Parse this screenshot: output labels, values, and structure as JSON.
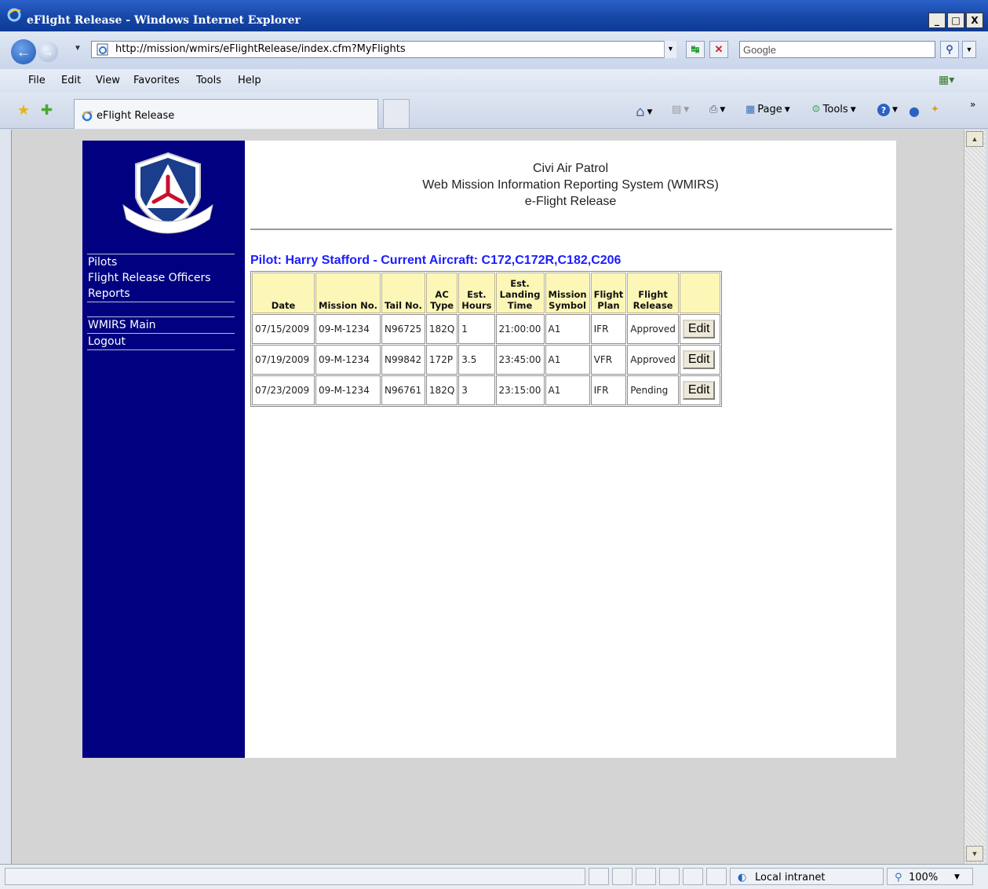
{
  "window": {
    "title": "eFlight Release - Windows Internet Explorer",
    "minimize": "_",
    "maximize": "□",
    "close": "X"
  },
  "address_bar": {
    "url": "http://mission/wmirs/eFlightRelease/index.cfm?MyFlights",
    "search_placeholder": "Google"
  },
  "menu": [
    "File",
    "Edit",
    "View",
    "Favorites",
    "Tools",
    "Help"
  ],
  "tab": {
    "label": "eFlight Release"
  },
  "commands": {
    "page": "Page",
    "tools": "Tools"
  },
  "sidebar": {
    "logo_text": "CIVIL AIR PATROL",
    "links": [
      "Pilots",
      "Flight Release Officers",
      "Reports",
      "WMIRS Main",
      "Logout"
    ]
  },
  "header": {
    "line1": "Civi Air Patrol",
    "line2": "Web Mission Information Reporting System (WMIRS)",
    "line3": "e-Flight Release"
  },
  "pilot_heading": "Pilot: Harry Stafford - Current Aircraft: C172,C172R,C182,C206",
  "table": {
    "headers": [
      "Date",
      "Mission No.",
      "Tail No.",
      "AC Type",
      "Est. Hours",
      "Est. Landing Time",
      "Mission Symbol",
      "Flight Plan",
      "Flight Release",
      ""
    ],
    "rows": [
      [
        "07/15/2009",
        "09-M-1234",
        "N96725",
        "182Q",
        "1",
        "21:00:00",
        "A1",
        "IFR",
        "Approved",
        "Edit"
      ],
      [
        "07/19/2009",
        "09-M-1234",
        "N99842",
        "172P",
        "3.5",
        "23:45:00",
        "A1",
        "VFR",
        "Approved",
        "Edit"
      ],
      [
        "07/23/2009",
        "09-M-1234",
        "N96761",
        "182Q",
        "3",
        "23:15:00",
        "A1",
        "IFR",
        "Pending",
        "Edit"
      ]
    ]
  },
  "status": {
    "zone": "Local intranet",
    "zoom": "100%"
  },
  "colors": {
    "nav_bg": "#000080",
    "heading": "#1c1cff",
    "header_cell": "#fdf7b7"
  }
}
